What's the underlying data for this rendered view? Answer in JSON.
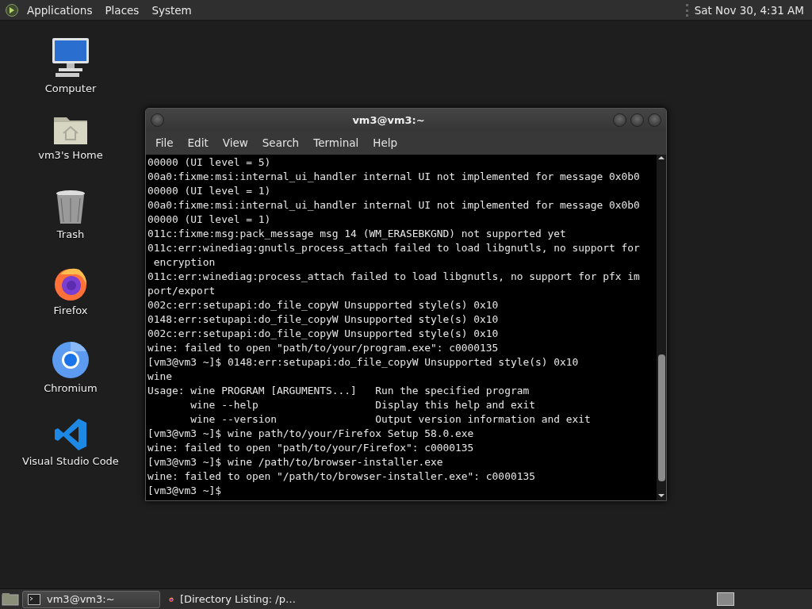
{
  "top_panel": {
    "menus": [
      "Applications",
      "Places",
      "System"
    ],
    "clock": "Sat Nov 30,  4:31 AM"
  },
  "desktop_icons": [
    {
      "kind": "computer",
      "label": "Computer"
    },
    {
      "kind": "home",
      "label": "vm3's Home"
    },
    {
      "kind": "trash",
      "label": "Trash"
    },
    {
      "kind": "firefox",
      "label": "Firefox"
    },
    {
      "kind": "chromium",
      "label": "Chromium"
    },
    {
      "kind": "vscode",
      "label": "Visual Studio Code"
    }
  ],
  "terminal_window": {
    "title": "vm3@vm3:~",
    "menus": [
      "File",
      "Edit",
      "View",
      "Search",
      "Terminal",
      "Help"
    ],
    "lines": [
      "00000 (UI level = 5)",
      "00a0:fixme:msi:internal_ui_handler internal UI not implemented for message 0x0b0",
      "00000 (UI level = 1)",
      "00a0:fixme:msi:internal_ui_handler internal UI not implemented for message 0x0b0",
      "00000 (UI level = 1)",
      "011c:fixme:msg:pack_message msg 14 (WM_ERASEBKGND) not supported yet",
      "011c:err:winediag:gnutls_process_attach failed to load libgnutls, no support for",
      " encryption",
      "011c:err:winediag:process_attach failed to load libgnutls, no support for pfx im",
      "port/export",
      "002c:err:setupapi:do_file_copyW Unsupported style(s) 0x10",
      "0148:err:setupapi:do_file_copyW Unsupported style(s) 0x10",
      "002c:err:setupapi:do_file_copyW Unsupported style(s) 0x10",
      "wine: failed to open \"path/to/your/program.exe\": c0000135",
      "[vm3@vm3 ~]$ 0148:err:setupapi:do_file_copyW Unsupported style(s) 0x10",
      "wine",
      "Usage: wine PROGRAM [ARGUMENTS...]   Run the specified program",
      "       wine --help                   Display this help and exit",
      "       wine --version                Output version information and exit",
      "[vm3@vm3 ~]$ wine path/to/your/Firefox Setup 58.0.exe",
      "wine: failed to open \"path/to/your/Firefox\": c0000135",
      "[vm3@vm3 ~]$ wine /path/to/browser-installer.exe",
      "wine: failed to open \"/path/to/browser-installer.exe\": c0000135",
      "[vm3@vm3 ~]$"
    ]
  },
  "taskbar": {
    "items": [
      {
        "kind": "terminal",
        "label": "vm3@vm3:~",
        "selected": true
      },
      {
        "kind": "firefox",
        "label": "[Directory Listing: /p…",
        "selected": false
      }
    ]
  }
}
